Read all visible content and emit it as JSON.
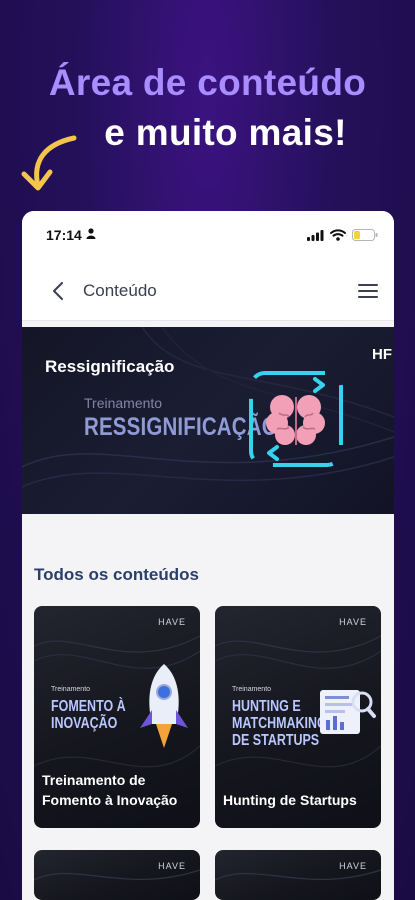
{
  "headline": {
    "line1": "Área de conteúdo",
    "line2": "e muito mais!"
  },
  "statusbar": {
    "time": "17:14"
  },
  "navbar": {
    "title": "Conteúdo"
  },
  "banner": {
    "title": "Ressignificação",
    "subtitle": "Treinamento",
    "big": "RESSIGNIFICAÇÃO",
    "logo": "HF"
  },
  "section": {
    "title": "Todos os conteúdos"
  },
  "cards": [
    {
      "small": "Treinamento",
      "big": "FOMENTO À\nINOVAÇÃO",
      "label": "Treinamento de Fomento à Inovação",
      "logo": "HAVE"
    },
    {
      "small": "Treinamento",
      "big": "HUNTING E\nMATCHMAKING\nDE STARTUPS",
      "label": "Hunting de Startups",
      "logo": "HAVE"
    },
    {
      "logo": "HAVE"
    },
    {
      "logo": "HAVE"
    }
  ],
  "colors": {
    "accent": "#a98cff",
    "section_title": "#2a3f6b",
    "brain_pink": "#f2a0b8",
    "brain_cyan": "#35d3ee"
  }
}
